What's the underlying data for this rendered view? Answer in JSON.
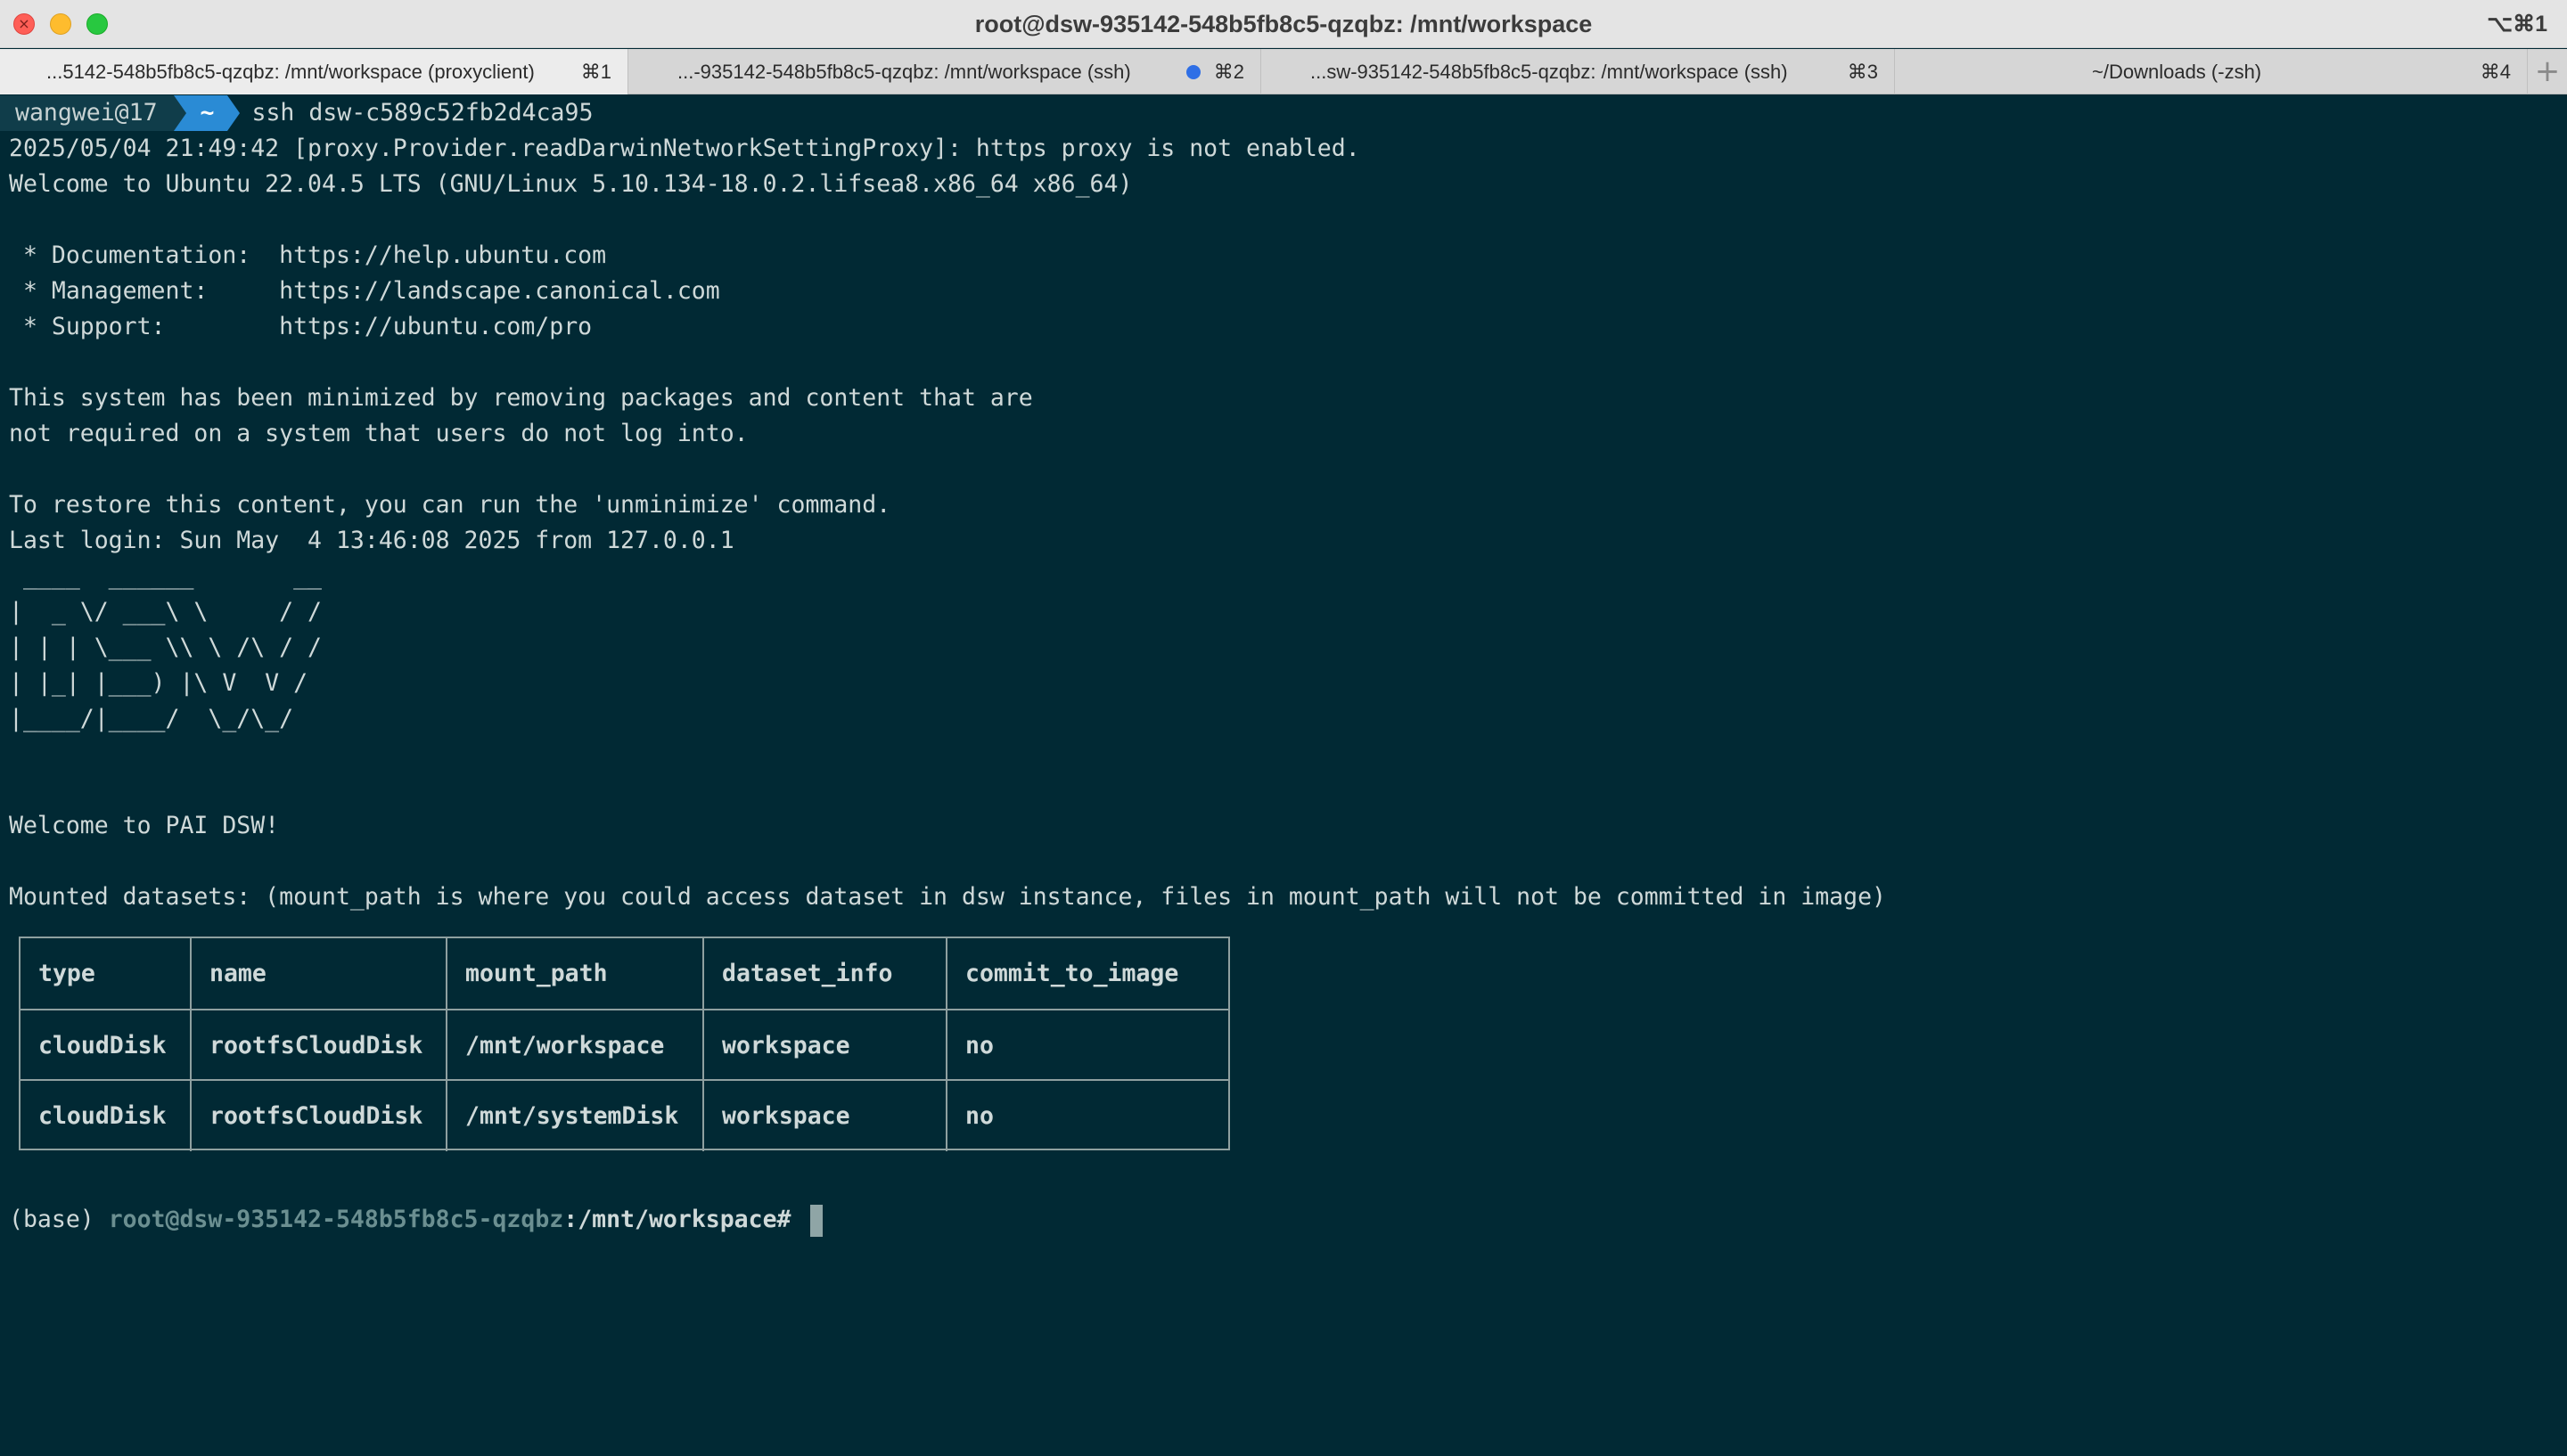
{
  "window": {
    "title": "root@dsw-935142-548b5fb8c5-qzqbz: /mnt/workspace",
    "shortcut": "⌥⌘1"
  },
  "tabs": [
    {
      "label": "...5142-548b5fb8c5-qzqbz: /mnt/workspace (proxyclient)",
      "key": "⌘1",
      "active": true
    },
    {
      "label": "...-935142-548b5fb8c5-qzqbz: /mnt/workspace (ssh)",
      "key": "⌘2",
      "active": false,
      "indicator": true
    },
    {
      "label": "...sw-935142-548b5fb8c5-qzqbz: /mnt/workspace (ssh)",
      "key": "⌘3",
      "active": false
    },
    {
      "label": "~/Downloads (-zsh)",
      "key": "⌘4",
      "active": false
    }
  ],
  "tab_add": "+",
  "terminal": {
    "prompt": {
      "user": "wangwei@17",
      "dir": "~",
      "command": "ssh dsw-c589c52fb2d4ca95"
    },
    "lines": [
      "2025/05/04 21:49:42 [proxy.Provider.readDarwinNetworkSettingProxy]: https proxy is not enabled.",
      "Welcome to Ubuntu 22.04.5 LTS (GNU/Linux 5.10.134-18.0.2.lifsea8.x86_64 x86_64)",
      "",
      " * Documentation:  https://help.ubuntu.com",
      " * Management:     https://landscape.canonical.com",
      " * Support:        https://ubuntu.com/pro",
      "",
      "This system has been minimized by removing packages and content that are",
      "not required on a system that users do not log into.",
      "",
      "To restore this content, you can run the 'unminimize' command.",
      "Last login: Sun May  4 13:46:08 2025 from 127.0.0.1",
      " ____  ______       __",
      "|  _ \\/ ___\\ \\     / /",
      "| | | \\___ \\\\ \\ /\\ / /",
      "| |_| |___) |\\ V  V /",
      "|____/|____/  \\_/\\_/",
      "",
      "",
      "Welcome to PAI DSW!",
      "",
      "Mounted datasets: (mount_path is where you could access dataset in dsw instance, files in mount_path will not be committed in image)"
    ],
    "table": {
      "headers": [
        "type",
        "name",
        "mount_path",
        "dataset_info",
        "commit_to_image"
      ],
      "rows": [
        [
          "cloudDisk",
          "rootfsCloudDisk",
          "/mnt/workspace",
          "workspace",
          "no"
        ],
        [
          "cloudDisk",
          "rootfsCloudDisk",
          "/mnt/systemDisk",
          "workspace",
          "no"
        ]
      ]
    },
    "final_prompt": {
      "env": "(base) ",
      "host": "root@dsw-935142-548b5fb8c5-qzqbz",
      "path": ":/mnt/workspace# "
    }
  }
}
